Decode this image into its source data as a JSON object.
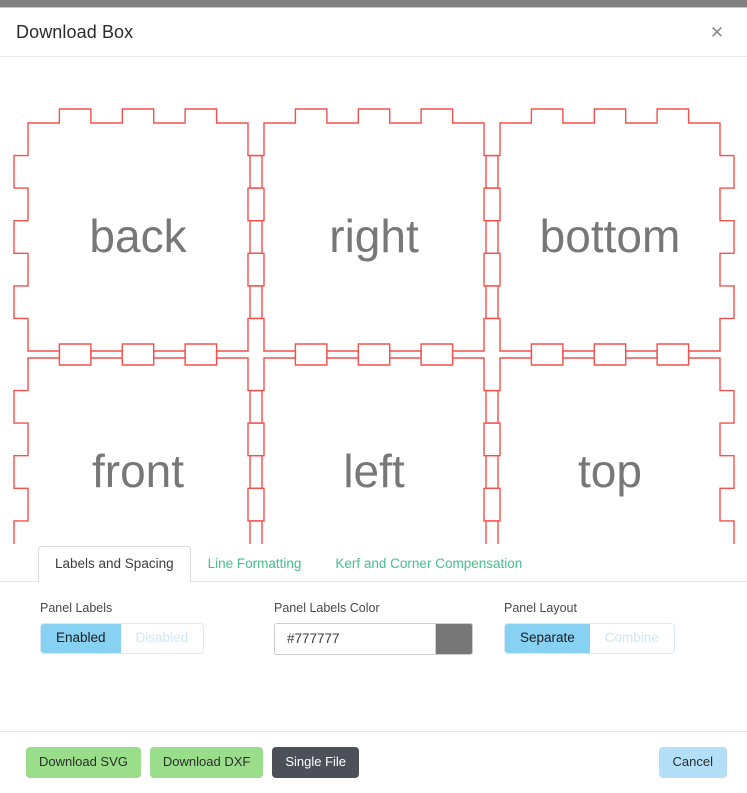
{
  "window": {
    "title": "Download Box",
    "close_icon": "close-icon"
  },
  "preview": {
    "stroke_color": "#f4514d",
    "label_color": "#777777",
    "panels": [
      {
        "label": "back",
        "col": 0,
        "row": 0
      },
      {
        "label": "right",
        "col": 1,
        "row": 0
      },
      {
        "label": "bottom",
        "col": 2,
        "row": 0
      },
      {
        "label": "front",
        "col": 0,
        "row": 1
      },
      {
        "label": "left",
        "col": 1,
        "row": 1
      },
      {
        "label": "top",
        "col": 2,
        "row": 1
      }
    ]
  },
  "tabs": [
    {
      "label": "Labels and Spacing",
      "active": true
    },
    {
      "label": "Line Formatting",
      "active": false
    },
    {
      "label": "Kerf and Corner Compensation",
      "active": false
    }
  ],
  "options": {
    "panel_labels": {
      "label": "Panel Labels",
      "options": [
        "Enabled",
        "Disabled"
      ],
      "selected": "Enabled"
    },
    "panel_labels_color": {
      "label": "Panel Labels Color",
      "value": "#777777",
      "placeholder": "#777777",
      "swatch_color": "#777777"
    },
    "panel_layout": {
      "label": "Panel Layout",
      "options": [
        "Separate",
        "Combine"
      ],
      "selected": "Separate"
    }
  },
  "footer": {
    "download_svg": "Download SVG",
    "download_dxf": "Download DXF",
    "single_file": "Single File",
    "cancel": "Cancel"
  },
  "colors": {
    "accent_green": "#45c08a",
    "toggle_blue": "#87d2f2",
    "button_green": "#9ade8b",
    "button_dark": "#4b5059",
    "button_blue": "#b3e0f7",
    "panel_stroke": "#f4514d"
  }
}
